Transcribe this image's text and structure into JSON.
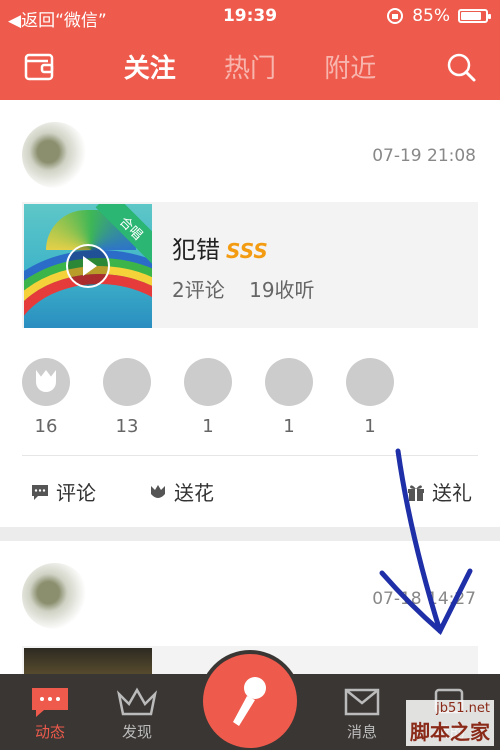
{
  "status_bar": {
    "back_label": "◀返回“微信”",
    "time": "19:39",
    "battery": "85%",
    "battery_level": 0.85
  },
  "nav": {
    "tabs": [
      {
        "label": "关注",
        "active": true
      },
      {
        "label": "热门",
        "active": false
      },
      {
        "label": "附近",
        "active": false
      }
    ],
    "left_icon": "wallet-icon",
    "right_icon": "search-icon"
  },
  "posts": [
    {
      "timestamp": "07-19 21:08",
      "song": {
        "title": "犯错",
        "badge": "SSS",
        "ribbon": "合唱",
        "comments": "2评论",
        "listens": "19收听"
      },
      "gifts": [
        {
          "name": "flower",
          "count": "16"
        },
        {
          "name": "user-1",
          "count": "13"
        },
        {
          "name": "user-2",
          "count": "1"
        },
        {
          "name": "user-3",
          "count": "1"
        },
        {
          "name": "user-4",
          "count": "1"
        }
      ],
      "actions": {
        "comment": "评论",
        "flower": "送花",
        "gift": "送礼"
      }
    },
    {
      "timestamp": "07-18 14:27"
    }
  ],
  "tab_bar": {
    "items": [
      {
        "label": "动态",
        "active": true
      },
      {
        "label": "发现",
        "active": false
      },
      {
        "label": "消息",
        "active": false
      },
      {
        "label": "我的",
        "active": false
      }
    ]
  },
  "watermark": {
    "line1": "jb51.net",
    "line2": "脚本之家"
  },
  "colors": {
    "accent": "#ee5b4c",
    "tabbar_bg": "#3a3634",
    "badge": "#f39c12",
    "ribbon": "#2bb673",
    "annotation_arrow": "#1f2fa8"
  }
}
